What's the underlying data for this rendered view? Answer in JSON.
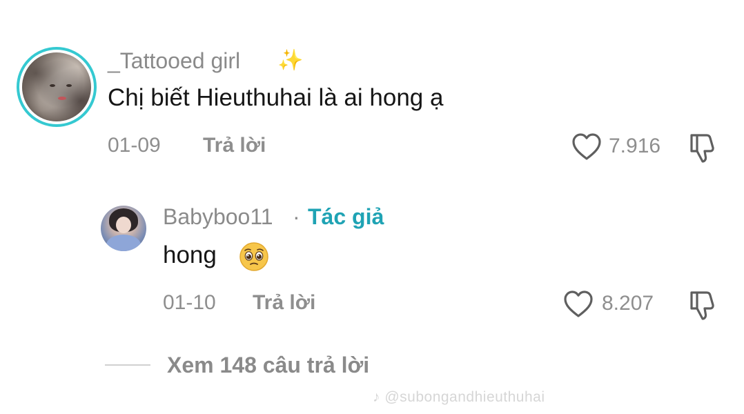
{
  "comments": [
    {
      "username": "_Tattooed girl",
      "badge": "✨",
      "text": "Chị biết Hieuthuhai là ai hong ạ",
      "date": "01-09",
      "reply_label": "Trả lời",
      "likes": "7.916"
    },
    {
      "username": "Babyboo11",
      "separator": "·",
      "author_label": "Tác giả",
      "text": "hong",
      "date": "01-10",
      "reply_label": "Trả lời",
      "likes": "8.207"
    }
  ],
  "view_replies": "Xem 148 câu trả lời",
  "watermark": "@subongandhieuthuhai",
  "colors": {
    "accent_ring": "#35c9d1",
    "author_teal": "#1fa3b4",
    "meta_gray": "#8e8e8e",
    "text_dark": "#161616"
  },
  "icons": {
    "like": "heart-outline-icon",
    "dislike": "thumbs-down-outline-icon",
    "emoji": "pleading-face-emoji"
  }
}
